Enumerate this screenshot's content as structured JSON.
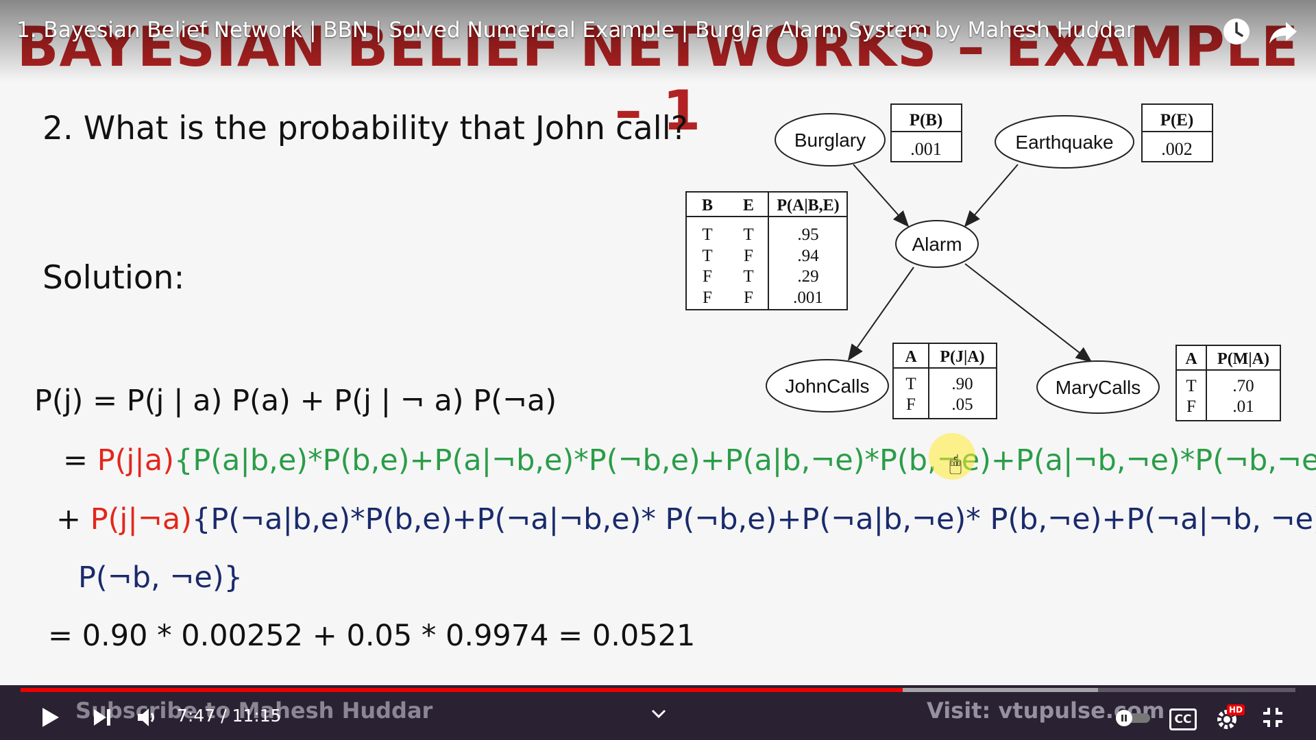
{
  "video": {
    "title": "1. Bayesian Belief Network | BBN | Solved Numerical Example | Burglar Alarm System by Mahesh Huddar",
    "time_current": "7:47",
    "time_total": "11:15",
    "time_separator": " / ",
    "progress_fraction": 0.692,
    "buffer_fraction": 0.845
  },
  "slide": {
    "title": "BAYESIAN BELIEF NETWORKS – EXAMPLE – 1",
    "question": "2. What is the probability that John call?",
    "solution_label": "Solution:",
    "eq1": "P(j)  = P(j | a) P(a) + P(j | ¬ a) P(¬a)",
    "eq2_prefix": "= ",
    "eq2_red": "P(j|a)",
    "eq2_green": "{P(a|b,e)*P(b,e)+P(a|¬b,e)*P(¬b,e)+P(a|b,¬e)*P(b,¬e)+P(a|¬b,¬e)*P(¬b,¬e)}",
    "eq3_prefix": "+ ",
    "eq3_red": "P(j|¬a)",
    "eq3_navy": "{P(¬a|b,e)*P(b,e)+P(¬a|¬b,e)* P(¬b,e)+P(¬a|b,¬e)* P(b,¬e)+P(¬a|¬b, ¬e)*",
    "eq4": "P(¬b, ¬e)}",
    "eq5": "= 0.90 * 0.00252 + 0.05 * 0.9974 = 0.0521"
  },
  "network": {
    "nodes": {
      "burglary": "Burglary",
      "earthquake": "Earthquake",
      "alarm": "Alarm",
      "john": "JohnCalls",
      "mary": "MaryCalls"
    },
    "pb": {
      "header": "P(B)",
      "value": ".001"
    },
    "pe": {
      "header": "P(E)",
      "value": ".002"
    },
    "alarm_cpt": {
      "headers": [
        "B",
        "E",
        "P(A|B,E)"
      ],
      "rows": [
        [
          "T",
          "T",
          ".95"
        ],
        [
          "T",
          "F",
          ".94"
        ],
        [
          "F",
          "T",
          ".29"
        ],
        [
          "F",
          "F",
          ".001"
        ]
      ]
    },
    "john_cpt": {
      "headers": [
        "A",
        "P(J|A)"
      ],
      "rows": [
        [
          "T",
          ".90"
        ],
        [
          "F",
          ".05"
        ]
      ]
    },
    "mary_cpt": {
      "headers": [
        "A",
        "P(M|A)"
      ],
      "rows": [
        [
          "T",
          ".70"
        ],
        [
          "F",
          ".01"
        ]
      ]
    }
  },
  "overlay": {
    "subscribe": "Subscribe to Mahesh Huddar",
    "visit": "Visit: vtupulse.com"
  },
  "icons": {
    "watch_later": "clock-icon",
    "share": "share-icon",
    "play": "play-icon",
    "next": "next-icon",
    "volume": "volume-icon",
    "chevron": "chevron-down-icon",
    "autoplay": "autoplay-toggle",
    "captions": "cc-icon",
    "settings": "gear-icon",
    "exit_fullscreen": "exit-fullscreen-icon"
  },
  "controls": {
    "cc_label": "CC",
    "hd_badge": "HD"
  },
  "colors": {
    "title_red": "#b22222",
    "red": "#e3261c",
    "green": "#2a9d48",
    "navy": "#1a2a6c",
    "progress": "#e00"
  }
}
